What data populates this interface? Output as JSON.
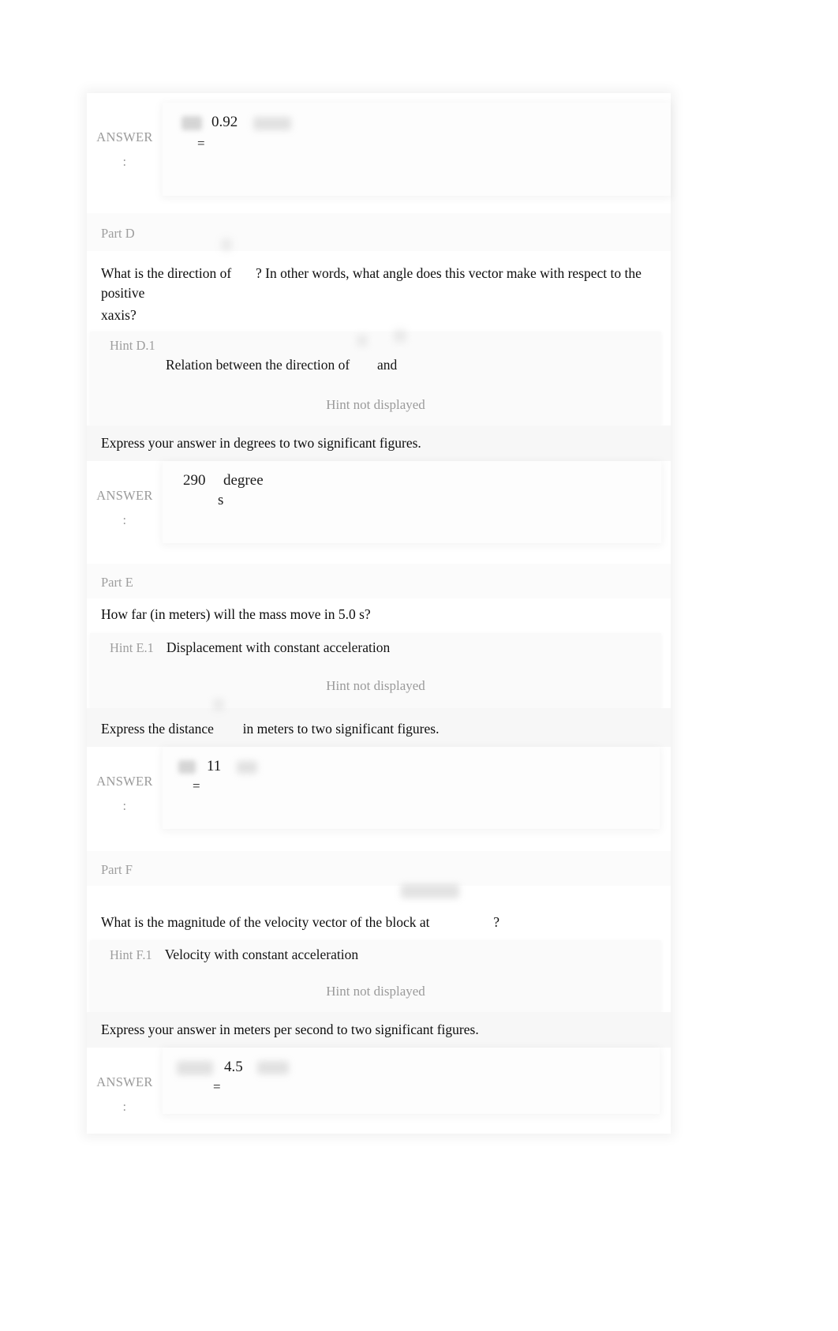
{
  "document": {
    "title": "Physics homework problem parts D, E, F"
  },
  "answer_label": "ANSWER",
  "answer_colon": ":",
  "hint_not_displayed": "Hint not displayed",
  "partC_answer": {
    "value": "0.92",
    "equals": "=",
    "symbol_alt": "blurred-variable-image",
    "unit_alt": "blurred-unit-image"
  },
  "partD": {
    "part_label": "Part D",
    "question_before": "What is the direction of",
    "question_after": "? In other words, what angle does this vector make with respect to the positive",
    "question_tail": "xaxis?",
    "hint": {
      "id": "Hint D.1",
      "body_before": "Relation between the direction of",
      "body_mid": "and",
      "not_displayed": "Hint not displayed"
    },
    "express": "Express your answer in degrees to two significant figures.",
    "answer": {
      "value": "290",
      "unit_line1": "degree",
      "unit_line2": "s"
    }
  },
  "partE": {
    "part_label": "Part E",
    "question": "How far (in meters) will the mass move in 5.0 s?",
    "hint": {
      "id": "Hint E.1",
      "title": "Displacement with constant acceleration",
      "not_displayed": "Hint not displayed"
    },
    "express_before": "Express the distance",
    "express_after": "in meters to two significant figures.",
    "answer": {
      "value": "11",
      "equals": "=",
      "symbol_alt": "blurred-variable-image",
      "unit_alt": "blurred-unit-image"
    }
  },
  "partF": {
    "part_label": "Part F",
    "question_before": "What is the magnitude of the velocity vector of the block at",
    "question_after": "?",
    "hint": {
      "id": "Hint F.1",
      "title": "Velocity with constant acceleration",
      "not_displayed": "Hint not displayed"
    },
    "express": "Express your answer in meters per second to two significant figures.",
    "answer": {
      "value": "4.5",
      "equals": "=",
      "symbol_alt": "blurred-variable-image",
      "unit_alt": "blurred-unit-image"
    }
  },
  "colors": {
    "page_background": "#ffffff",
    "label_gray": "#9e9e9e",
    "body_text": "#0d0d0d",
    "panel_gray": "#fafafa"
  }
}
